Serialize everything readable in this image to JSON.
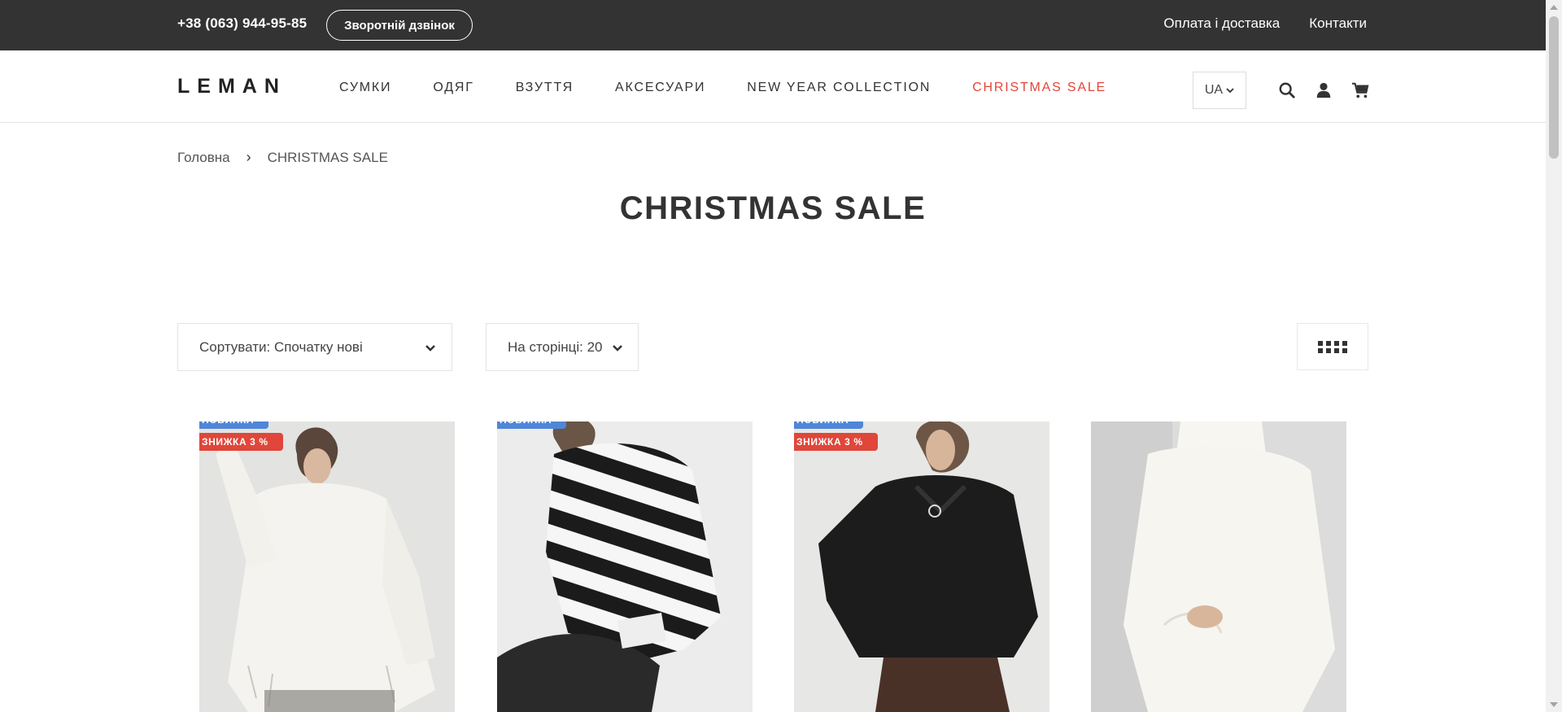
{
  "topbar": {
    "phone": "+38 (063) 944-95-85",
    "callback_label": "Зворотній дзвінок",
    "links": [
      "Оплата і доставка",
      "Контакти"
    ]
  },
  "header": {
    "logo": "LEMAN",
    "nav": [
      "СУМКИ",
      "ОДЯГ",
      "ВЗУТТЯ",
      "АКСЕСУАРИ",
      "NEW YEAR COLLECTION",
      "CHRISTMAS SALE"
    ],
    "language": "UA",
    "icons": [
      "search-icon",
      "user-icon",
      "cart-icon"
    ]
  },
  "breadcrumb": {
    "home": "Головна",
    "separator": "›",
    "current": "CHRISTMAS SALE"
  },
  "page_title": "CHRISTMAS SALE",
  "toolbar": {
    "sort_label": "Сортувати: Спочатку нові",
    "per_page_label": "На сторінці: 20",
    "view_icon": "grid-view-icon"
  },
  "badges": {
    "new_label": "НОВИНКА",
    "sale_label": "ЗНИЖКА 3 %"
  },
  "products": [
    {
      "badges": [
        "НОВИНКА",
        "ЗНИЖКА 3 %"
      ],
      "image": "white distressed oversized knit sweater"
    },
    {
      "badges": [
        "НОВИНКА"
      ],
      "image": "black and white striped sweater"
    },
    {
      "badges": [
        "НОВИНКА",
        "ЗНИЖКА 3 %"
      ],
      "image": "black zip-neck knit sweater"
    },
    {
      "badges": [],
      "image": "cream turtleneck oversized sweater"
    }
  ],
  "colors": {
    "topbar_bg": "#333333",
    "sale_accent": "#e0463a",
    "new_badge": "#4f86d8"
  }
}
